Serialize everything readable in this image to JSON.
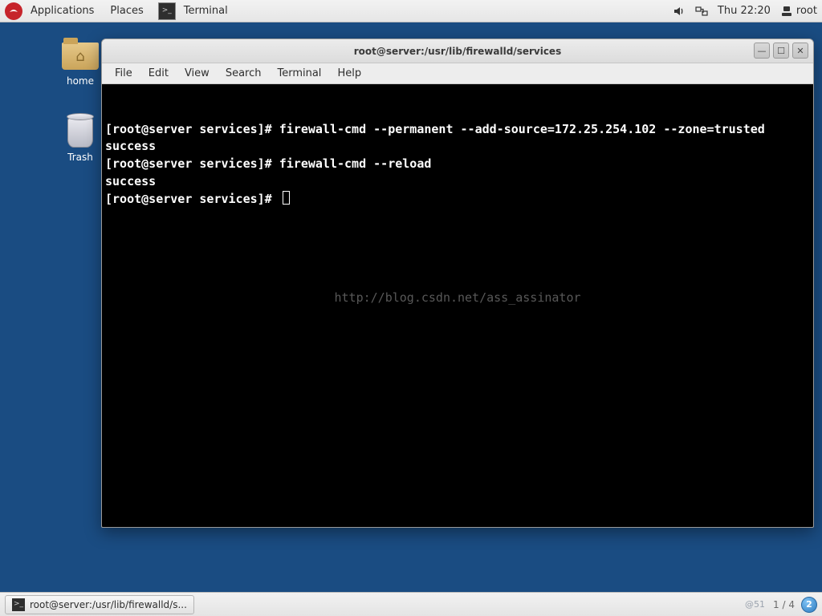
{
  "top_panel": {
    "applications": "Applications",
    "places": "Places",
    "task_app": "Terminal",
    "clock": "Thu 22:20",
    "user": "root"
  },
  "desktop": {
    "home_label": "home",
    "trash_label": "Trash"
  },
  "window": {
    "title": "root@server:/usr/lib/firewalld/services",
    "menu": {
      "file": "File",
      "edit": "Edit",
      "view": "View",
      "search": "Search",
      "terminal": "Terminal",
      "help": "Help"
    },
    "win_buttons": {
      "minimize": "—",
      "maximize": "☐",
      "close": "✕"
    }
  },
  "terminal": {
    "lines": [
      "[root@server services]# firewall-cmd --permanent --add-source=172.25.254.102 --zone=trusted",
      "success",
      "[root@server services]# firewall-cmd --reload",
      "success",
      "[root@server services]# "
    ],
    "watermark": "http://blog.csdn.net/ass_assinator"
  },
  "bottom_panel": {
    "task_label": "root@server:/usr/lib/firewalld/s...",
    "faint": "@51",
    "workspace_indicator": "1 / 4",
    "badge": "2"
  }
}
